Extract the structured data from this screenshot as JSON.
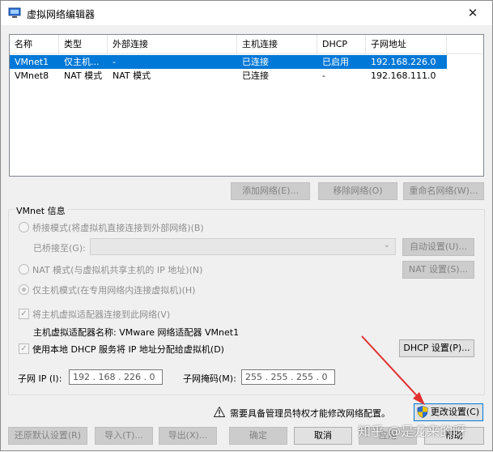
{
  "window": {
    "title": "虚拟网络编辑器",
    "close_glyph": "✕"
  },
  "table": {
    "headers": [
      "名称",
      "类型",
      "外部连接",
      "主机连接",
      "DHCP",
      "子网地址"
    ],
    "rows": [
      {
        "name": "VMnet1",
        "type": "仅主机...",
        "external": "-",
        "host": "已连接",
        "dhcp": "已启用",
        "subnet": "192.168.226.0",
        "selected": true
      },
      {
        "name": "VMnet8",
        "type": "NAT 模式",
        "external": "NAT 模式",
        "host": "已连接",
        "dhcp": "-",
        "subnet": "192.168.111.0",
        "selected": false
      }
    ]
  },
  "table_buttons": {
    "add": "添加网络(E)...",
    "remove": "移除网络(O)",
    "rename": "重命名网络(W)..."
  },
  "vmnet_info": {
    "title": "VMnet 信息",
    "bridge_mode": "桥接模式(将虚拟机直接连接到外部网络)(B)",
    "bridged_to_label": "已桥接至(G):",
    "bridged_to_value": "",
    "auto_settings": "自动设置(U)...",
    "nat_mode": "NAT 模式(与虚拟机共享主机的 IP 地址)(N)",
    "nat_settings": "NAT 设置(S)...",
    "host_only_mode": "仅主机模式(在专用网络内连接虚拟机)(H)",
    "connect_adapter": "将主机虚拟适配器连接到此网络(V)",
    "adapter_name_label": "主机虚拟适配器名称: VMware 网络适配器 VMnet1",
    "use_dhcp": "使用本地 DHCP 服务将 IP 地址分配给虚拟机(D)",
    "dhcp_settings": "DHCP 设置(P)...",
    "subnet_ip_label": "子网 IP (I):",
    "subnet_ip_value": "192 . 168 . 226 .  0",
    "subnet_mask_label": "子网掩码(M):",
    "subnet_mask_value": "255 . 255 . 255 .  0"
  },
  "admin_notice": "需要具备管理员特权才能修改网络配置。",
  "change_settings": "更改设置(C)",
  "bottom_buttons": {
    "restore_defaults": "还原默认设置(R)",
    "import": "导入(T)...",
    "export": "导出(X)...",
    "ok": "确定",
    "cancel": "取消",
    "apply": "应用",
    "help": "帮助"
  },
  "watermark": "知乎 @是龙来的呀",
  "colors": {
    "selection": "#0078d7",
    "annotation_arrow": "#e03030",
    "shield_blue": "#2a6fd6",
    "shield_yellow": "#f2c300"
  },
  "icons": [
    "app-network-icon",
    "close-icon",
    "warning-icon",
    "uac-shield-icon",
    "dropdown-arrow-icon"
  ]
}
